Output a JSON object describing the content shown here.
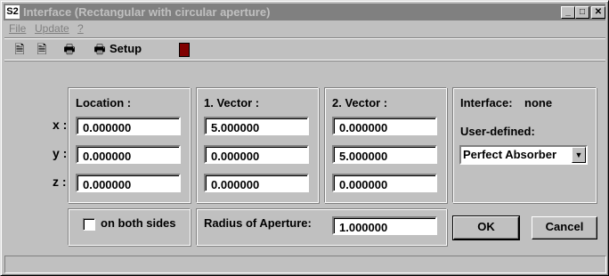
{
  "window": {
    "title": "Interface (Rectangular with circular aperture)",
    "app_icon": "S2",
    "controls": [
      "minimize-icon",
      "maximize-icon",
      "close-icon"
    ]
  },
  "menu": [
    "File",
    "Update",
    "?"
  ],
  "toolbar": {
    "icons": [
      "new-document-icon",
      "save-document-icon",
      "print-icon",
      "print-setup-icon",
      "exit-door-icon"
    ],
    "setup_label": "Setup"
  },
  "location": {
    "header": "Location :",
    "x": "0.000000",
    "y": "0.000000",
    "z": "0.000000"
  },
  "vector1": {
    "header": "1. Vector :",
    "x": "5.000000",
    "y": "0.000000",
    "z": "0.000000"
  },
  "vector2": {
    "header": "2. Vector :",
    "x": "0.000000",
    "y": "5.000000",
    "z": "0.000000"
  },
  "axes": [
    "x :",
    "y :",
    "z :"
  ],
  "interface": {
    "label": "Interface:",
    "value": "none",
    "user_defined_label": "User-defined:",
    "selected": "Perfect Absorber"
  },
  "options": {
    "both_sides_label": "on both sides",
    "both_sides_checked": false
  },
  "aperture": {
    "label": "Radius of Aperture:",
    "value": "1.000000"
  },
  "buttons": {
    "ok": "OK",
    "cancel": "Cancel"
  }
}
